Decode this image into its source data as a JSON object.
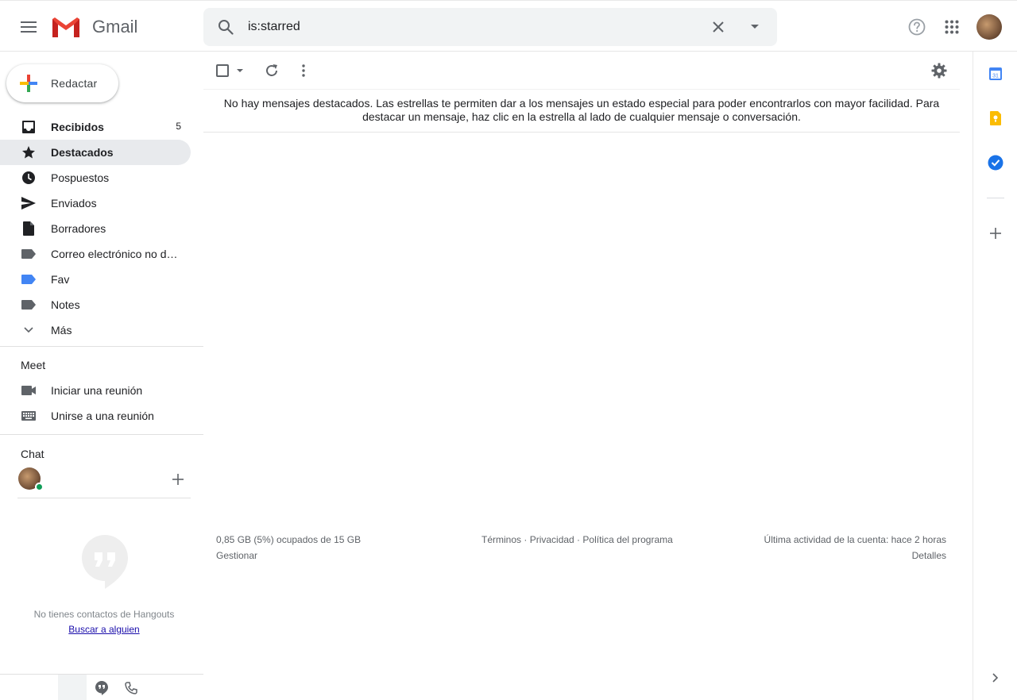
{
  "app": {
    "name": "Gmail"
  },
  "colors": {
    "accent_red": "#ea4335",
    "accent_blue": "#4285f4",
    "accent_yellow": "#fbbc04",
    "accent_green": "#34a853",
    "active_nav_bg": "#e8eaed",
    "online_green": "#0f9d58"
  },
  "header": {
    "search": {
      "value": "is:starred",
      "icon": "search-icon",
      "clear_icon": "close-icon",
      "options_icon": "caret-down-icon"
    },
    "help_icon": "help-icon",
    "apps_icon": "apps-grid-icon"
  },
  "sidebar": {
    "compose_label": "Redactar",
    "items": [
      {
        "label": "Recibidos",
        "count": "5",
        "icon": "inbox-icon",
        "bold": true
      },
      {
        "label": "Destacados",
        "icon": "star-icon",
        "bold": true,
        "active": true
      },
      {
        "label": "Pospuestos",
        "icon": "clock-icon"
      },
      {
        "label": "Enviados",
        "icon": "send-icon"
      },
      {
        "label": "Borradores",
        "icon": "draft-icon"
      },
      {
        "label": "Correo electrónico no d…",
        "icon": "label-icon"
      },
      {
        "label": "Fav",
        "icon": "label-icon",
        "color": "#4285f4"
      },
      {
        "label": "Notes",
        "icon": "label-icon"
      },
      {
        "label": "Más",
        "icon": "chevron-down-icon"
      }
    ],
    "meet": {
      "title": "Meet",
      "items": [
        {
          "label": "Iniciar una reunión",
          "icon": "video-icon"
        },
        {
          "label": "Unirse a una reunión",
          "icon": "keyboard-icon"
        }
      ]
    },
    "chat": {
      "title": "Chat",
      "empty_text": "No tienes contactos de Hangouts",
      "find_link": "Buscar a alguien"
    }
  },
  "main": {
    "empty_message": "No hay mensajes destacados. Las estrellas te permiten dar a los mensajes un estado especial para poder encontrarlos con mayor facilidad. Para destacar un mensaje, haz clic en la estrella al lado de cualquier mensaje o conversación.",
    "footer": {
      "storage": "0,85 GB (5%) ocupados de 15 GB",
      "manage": "Gestionar",
      "terms": "Términos",
      "privacy": "Privacidad",
      "policy": "Política del programa",
      "sep": " · ",
      "activity": "Última actividad de la cuenta: hace 2 horas",
      "details": "Detalles"
    }
  },
  "rail": {
    "items": [
      "calendar-icon",
      "keep-icon",
      "tasks-icon",
      "add-icon"
    ],
    "calendar_day": "31"
  }
}
